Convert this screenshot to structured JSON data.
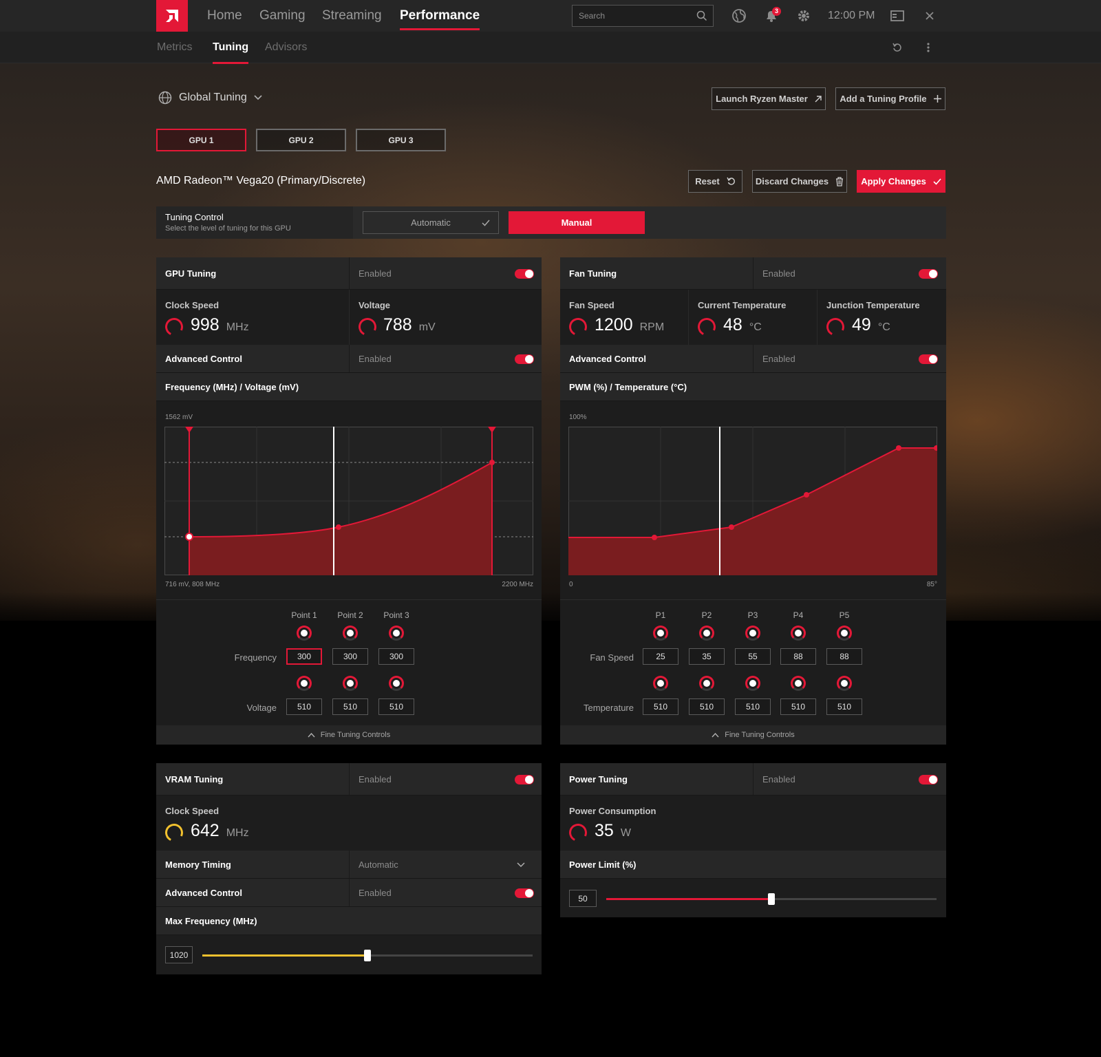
{
  "topbar": {
    "nav": [
      "Home",
      "Gaming",
      "Streaming",
      "Performance"
    ],
    "search_placeholder": "Search",
    "notification_count": "3",
    "time": "12:00 PM"
  },
  "subnav": [
    "Metrics",
    "Tuning",
    "Advisors"
  ],
  "header": {
    "scope": "Global Tuning",
    "launch_ryzen": "Launch Ryzen Master",
    "add_profile": "Add a Tuning Profile",
    "gpu_tabs": [
      "GPU 1",
      "GPU 2",
      "GPU 3"
    ],
    "gpu_name": "AMD Radeon™ Vega20 (Primary/Discrete)",
    "reset": "Reset",
    "discard": "Discard Changes",
    "apply": "Apply Changes"
  },
  "tuning_control": {
    "title": "Tuning Control",
    "subtitle": "Select the level of tuning for this GPU",
    "automatic": "Automatic",
    "manual": "Manual"
  },
  "gpu_tuning": {
    "title": "GPU Tuning",
    "status": "Enabled",
    "clock_label": "Clock Speed",
    "clock_value": "998",
    "clock_unit": "MHz",
    "voltage_label": "Voltage",
    "voltage_value": "788",
    "voltage_unit": "mV",
    "advanced_label": "Advanced Control",
    "advanced_status": "Enabled",
    "chart_title": "Frequency (MHz) / Voltage (mV)",
    "y_top": "1562 mV",
    "x_left": "716 mV, 808 MHz",
    "x_right": "2200 MHz",
    "points": [
      "Point 1",
      "Point 2",
      "Point 3"
    ],
    "freq_label": "Frequency",
    "freq_values": [
      "300",
      "300",
      "300"
    ],
    "volt_label": "Voltage",
    "volt_values": [
      "510",
      "510",
      "510"
    ],
    "fine_tuning": "Fine Tuning Controls"
  },
  "fan_tuning": {
    "title": "Fan Tuning",
    "status": "Enabled",
    "fan_label": "Fan Speed",
    "fan_value": "1200",
    "fan_unit": "RPM",
    "cur_temp_label": "Current Temperature",
    "cur_temp_value": "48",
    "temp_unit": "°C",
    "junc_label": "Junction Temperature",
    "junc_value": "49",
    "advanced_label": "Advanced Control",
    "advanced_status": "Enabled",
    "chart_title": "PWM (%) / Temperature (°C)",
    "y_top": "100%",
    "x_left": "0",
    "x_right": "85°",
    "points": [
      "P1",
      "P2",
      "P3",
      "P4",
      "P5"
    ],
    "speed_label": "Fan Speed",
    "speed_values": [
      "25",
      "35",
      "55",
      "88",
      "88"
    ],
    "temp_label": "Temperature",
    "temp_values": [
      "510",
      "510",
      "510",
      "510",
      "510"
    ],
    "fine_tuning": "Fine Tuning Controls"
  },
  "vram_tuning": {
    "title": "VRAM Tuning",
    "status": "Enabled",
    "clock_label": "Clock Speed",
    "clock_value": "642",
    "clock_unit": "MHz",
    "memory_label": "Memory Timing",
    "memory_value": "Automatic",
    "advanced_label": "Advanced Control",
    "advanced_status": "Enabled",
    "max_freq_label": "Max Frequency (MHz)",
    "max_freq_value": "1020",
    "slider_fraction": 0.5
  },
  "power_tuning": {
    "title": "Power Tuning",
    "status": "Enabled",
    "consumption_label": "Power Consumption",
    "consumption_value": "35",
    "consumption_unit": "W",
    "limit_label": "Power Limit (%)",
    "limit_value": "50",
    "slider_fraction": 0.5
  },
  "colors": {
    "accent": "#e31837",
    "vram_accent": "#f2c12e",
    "panel": "#1d1d1d"
  }
}
